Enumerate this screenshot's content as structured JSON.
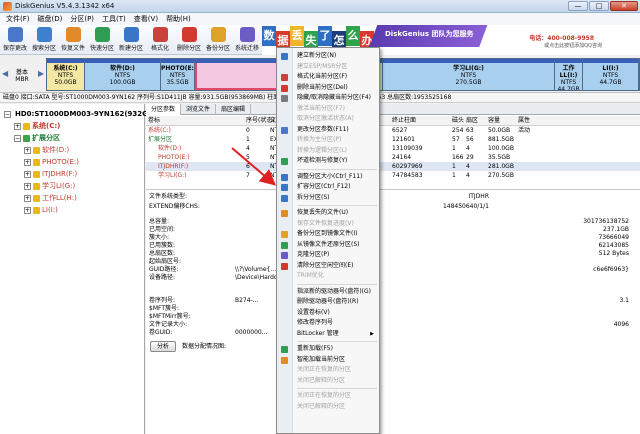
{
  "window": {
    "title": "DiskGenius V5.4.3.1342 x64",
    "min": "—",
    "max": "□",
    "close": "✕"
  },
  "menu": [
    "文件(F)",
    "磁盘(D)",
    "分区(P)",
    "工具(T)",
    "查看(V)",
    "帮助(H)"
  ],
  "toolbar": [
    {
      "label": "保存更改",
      "icon": "save-icon",
      "color": "#4a78c8"
    },
    {
      "label": "搜索分区",
      "icon": "search-icon",
      "color": "#3f7fd0"
    },
    {
      "label": "恢复文件",
      "icon": "recover-icon",
      "color": "#e08a2a"
    },
    {
      "label": "快速分区",
      "icon": "quick-partition-icon",
      "color": "#2f9e54"
    },
    {
      "label": "新建分区",
      "icon": "new-partition-icon",
      "color": "#3a76c6"
    },
    {
      "label": "格式化",
      "icon": "format-icon",
      "color": "#c8443a"
    },
    {
      "label": "删除分区",
      "icon": "delete-icon",
      "color": "#d23a2f"
    },
    {
      "label": "备份分区",
      "icon": "backup-icon",
      "color": "#e0a12a"
    },
    {
      "label": "系统迁移",
      "icon": "migrate-icon",
      "color": "#6a5ec6"
    }
  ],
  "banner": {
    "chars": [
      {
        "t": "数",
        "c": "#2d6fc4"
      },
      {
        "t": "据",
        "c": "#d8392b"
      },
      {
        "t": "丢",
        "c": "#f0b52a"
      },
      {
        "t": "失",
        "c": "#2fa24c"
      },
      {
        "t": "了",
        "c": "#2d6fc4"
      },
      {
        "t": "怎",
        "c": "#1c3d7a"
      },
      {
        "t": "么",
        "c": "#2fa24c"
      },
      {
        "t": "办",
        "c": "#d8392b"
      }
    ],
    "ribbon": "DiskGenius 团队为您服务",
    "phone": "电话：400-008-9958",
    "qq": "或点击此按钮添加QQ咨询"
  },
  "disk_map": {
    "left": "基本\nMBR",
    "partitions": [
      {
        "name": "系统(C:)",
        "fs": "NTFS",
        "size": "50.0GB",
        "w": 38,
        "color": "#f2e7a3"
      },
      {
        "name": "软件(D:)",
        "fs": "NTFS",
        "size": "100.0GB",
        "w": 76,
        "color": "#a9cfee"
      },
      {
        "name": "PHOTO(E:)",
        "fs": "NTFS",
        "size": "35.5GB",
        "w": 34,
        "color": "#a9cfee"
      },
      {
        "name": "",
        "fs": "",
        "size": "",
        "w": 166,
        "color": "#f4c8e0",
        "sel": true
      },
      {
        "name": "",
        "fs": "",
        "size": "",
        "w": 22,
        "color": "#c2e8b3"
      },
      {
        "name": "学习LI(G:)",
        "fs": "NTFS",
        "size": "270.5GB",
        "w": 172,
        "color": "#a9cfee"
      },
      {
        "name": "工作LL(I:)",
        "fs": "NTFS",
        "size": "44.7GB",
        "w": 28,
        "color": "#a9cfee"
      },
      {
        "name": "LI(I:)",
        "fs": "NTFS",
        "size": "44.7GB",
        "w": 56,
        "color": "#a9cfee"
      }
    ]
  },
  "status_line": "磁盘0 接口:SATA  型号:ST1000DM003-9YN162  序列号:S1D411JB  容量:931.5GB(953869MB)  柱面数:121601  磁头数:255  每道扇区数:63  总扇区数:1953525168",
  "tree": [
    {
      "text": "HD0:ST1000DM003-9YN162(932GB)",
      "lvl": 0,
      "box": "−",
      "color": "#7a7a7a"
    },
    {
      "text": "系统(C:)",
      "lvl": 1,
      "box": "+",
      "color": "#e8b820",
      "fc": "#c0392b"
    },
    {
      "text": "扩展分区",
      "lvl": 1,
      "box": "−",
      "color": "#3fa24c",
      "fc": "#1e7a34"
    },
    {
      "text": "软件(D:)",
      "lvl": 2,
      "box": "+",
      "color": "#e8b820",
      "fc": "#c0392b"
    },
    {
      "text": "PHOTO(E:)",
      "lvl": 2,
      "box": "+",
      "color": "#e8b820",
      "fc": "#c0392b"
    },
    {
      "text": "ITJDHR(F:)",
      "lvl": 2,
      "box": "+",
      "color": "#e8b820",
      "fc": "#c0392b"
    },
    {
      "text": "学习LI(G:)",
      "lvl": 2,
      "box": "+",
      "color": "#e8b820",
      "fc": "#c0392b"
    },
    {
      "text": "工作LL(H:)",
      "lvl": 2,
      "box": "+",
      "color": "#e8b820",
      "fc": "#c0392b"
    },
    {
      "text": "LI(I:)",
      "lvl": 2,
      "box": "+",
      "color": "#e8b820",
      "fc": "#c0392b"
    }
  ],
  "tabs": [
    "分区参数",
    "浏览文件",
    "扇区编辑"
  ],
  "table": {
    "headers": [
      "卷标",
      "序号(状态)",
      "文件系统",
      "标识",
      "起始柱面",
      "磁头",
      "扇区",
      "终止柱面",
      "磁头",
      "扇区",
      "容量",
      "属性"
    ],
    "rows": [
      {
        "c": [
          "系统(C:)",
          "0",
          "NTFS",
          "07",
          "0",
          "32",
          "33",
          "6527",
          "254",
          "63",
          "50.0GB",
          "活动"
        ],
        "color": "#c0392b"
      },
      {
        "c": [
          "扩展分区",
          "1",
          "EXTEND",
          "0F",
          "6527",
          "254",
          "63",
          "121601",
          "57",
          "56",
          "881.5GB",
          ""
        ],
        "color": "#1e7a34"
      },
      {
        "c": [
          "软件(D:)",
          "4",
          "NTFS",
          "07",
          "6528",
          "1",
          "4",
          "13109039",
          "1",
          "4",
          "100.0GB",
          ""
        ],
        "color": "#c0392b"
      },
      {
        "c": [
          "PHOTO(E:)",
          "5",
          "NTFS",
          "07",
          "19583",
          "1",
          "4",
          "24164",
          "166",
          "29",
          "35.5GB",
          ""
        ],
        "color": "#c0392b"
      },
      {
        "c": [
          "ITJDHR(F:)",
          "6",
          "NTFS",
          "07",
          "24165",
          "1",
          "4",
          "60297969",
          "1",
          "4",
          "281.0GB",
          ""
        ],
        "color": "#c0392b",
        "sel": true
      },
      {
        "c": [
          "学习LI(G:)",
          "7",
          "NTFS",
          "07",
          "60958",
          "1",
          "4",
          "74784583",
          "1",
          "4",
          "270.5GB",
          ""
        ],
        "color": "#c0392b"
      }
    ]
  },
  "details": {
    "fs_type_label": "文件系统类型:",
    "fs_type_value": "ITJDHR",
    "chs_label": "EXTEND偏移CHS:",
    "chs_value": "148450640/1/1",
    "lines": [
      {
        "k": "总容量:",
        "r": "301736138752"
      },
      {
        "k": "已用空间:",
        "r": "237.1GB"
      },
      {
        "k": "簇大小:",
        "r": "73666049"
      },
      {
        "k": "已用簇数:",
        "r": "62143085"
      },
      {
        "k": "总扇区数:",
        "r": "512 Bytes"
      },
      {
        "k": "起始扇区号:",
        "r": ""
      },
      {
        "k": "GUID路径:",
        "v": "\\\\?\\Volume{...}",
        "r": "c6e6f6963}"
      },
      {
        "k": "设备路径:",
        "v": "\\Device\\HarddiskVolume6",
        "r": ""
      }
    ],
    "lines2": [
      {
        "k": "卷序列号:",
        "v": "B274-...",
        "r": "3.1"
      },
      {
        "k": "$MFT簇号:",
        "v": "",
        "r": ""
      },
      {
        "k": "$MFTMirr簇号:",
        "v": "",
        "r": ""
      },
      {
        "k": "文件记录大小:",
        "v": "",
        "r": "4096"
      },
      {
        "k": "卷GUID:",
        "v": "0000000...",
        "r": ""
      }
    ],
    "analyze": "分析",
    "analyze_label": "数据分配情况图:"
  },
  "context_menu": [
    {
      "t": "建立新分区(N)",
      "d": false,
      "ic": "#3a76c6"
    },
    {
      "t": "建立ESP/MSR分区",
      "d": true
    },
    {
      "t": "格式化当前分区(F)",
      "d": false,
      "ic": "#c8443a"
    },
    {
      "t": "删除当前分区(Del)",
      "d": false,
      "ic": "#d23a2f"
    },
    {
      "t": "隐藏/取消隐藏当前分区(F4)",
      "d": false,
      "ic": "#7a7a7a"
    },
    {
      "t": "激活当前分区(F7)",
      "d": true
    },
    {
      "t": "取消分区激活状态(A)",
      "d": true
    },
    {
      "t": "更改分区参数(F11)",
      "d": false,
      "ic": "#4a78c8"
    },
    {
      "t": "转换为主分区(P)",
      "d": true
    },
    {
      "t": "转换为逻辑分区(L)",
      "d": true
    },
    {
      "t": "坏道检测与修复(Y)",
      "d": false,
      "ic": "#2f9e54",
      "sep": true
    },
    {
      "t": "调整分区大小(Ctrl_F11)",
      "d": false,
      "ic": "#3a76c6"
    },
    {
      "t": "扩容分区(Ctrl_F12)",
      "d": false,
      "ic": "#3a76c6"
    },
    {
      "t": "拆分分区(S)",
      "d": false,
      "ic": "#3a76c6",
      "sep": true
    },
    {
      "t": "恢复丢失的文件(U)",
      "d": false,
      "ic": "#e08a2a"
    },
    {
      "t": "保存文件恢复进度(V)",
      "d": true
    },
    {
      "t": "备份分区到镜像文件(I)",
      "d": false,
      "ic": "#e0a12a"
    },
    {
      "t": "从镜像文件还原分区(S)",
      "d": false,
      "ic": "#2f9e54"
    },
    {
      "t": "克隆分区(P)",
      "d": false,
      "ic": "#6a5ec6"
    },
    {
      "t": "清除分区空闲空间(E)",
      "d": false,
      "ic": "#d23a2f"
    },
    {
      "t": "TRIM优化",
      "d": true,
      "sep": true
    },
    {
      "t": "指派新的驱动器号(盘符)(G)",
      "d": false
    },
    {
      "t": "删除驱动器号(盘符)(R)",
      "d": false
    },
    {
      "t": "设置卷标(V)",
      "d": false
    },
    {
      "t": "修改卷序列号",
      "d": false
    },
    {
      "t": "BitLocker 管理",
      "d": false,
      "sub": true,
      "sep": true
    },
    {
      "t": "重新加载(F5)",
      "d": false,
      "ic": "#2f9e54"
    },
    {
      "t": "智能加载当前分区",
      "d": false,
      "ic": "#e08a2a"
    },
    {
      "t": "关闭正在恢复的分区",
      "d": true
    },
    {
      "t": "关闭已解释的分区",
      "d": true,
      "sep": true
    },
    {
      "t": "关闭正在恢复的分区",
      "d": true
    },
    {
      "t": "关闭已解释的分区",
      "d": true
    }
  ]
}
